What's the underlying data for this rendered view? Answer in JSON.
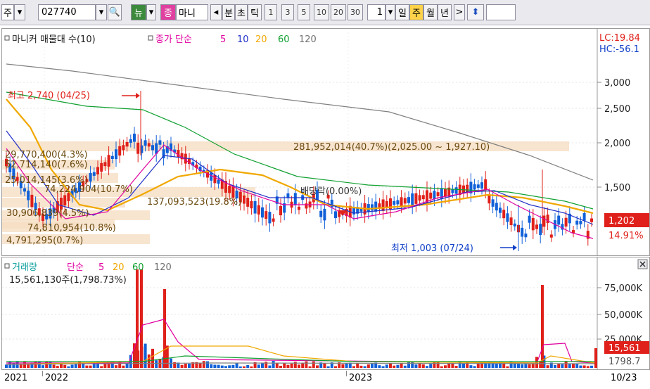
{
  "toolbar": {
    "market": "주",
    "code": "027740",
    "news_label": "뉴",
    "jong_label": "종",
    "name": "마니",
    "periods": [
      "분",
      "초",
      "틱"
    ],
    "intervals": [
      "1",
      "3",
      "5",
      "10",
      "20",
      "30"
    ],
    "count": "1",
    "day": "일",
    "week": "주",
    "month": "월",
    "year": "년"
  },
  "main_chart": {
    "legend_name": "마니커 매물대 수(10)",
    "legend_ma_label": "종가 단순",
    "ma_periods": [
      "5",
      "10",
      "20",
      "60",
      "120"
    ],
    "lc_text": "LC:19.84",
    "hc_text": "HC:-56.1",
    "y_ticks": [
      "3,000",
      "2,500",
      "2,000",
      "1,500"
    ],
    "current_price": "1,202",
    "current_change": "14.91%",
    "high_note": "최고 2,740 (04/25)",
    "low_note": "최저 1,003 (07/24)",
    "ex_div_note": "배당락(0.00%)",
    "volume_profile": [
      "281,952,014(40.7%)(2,025.00 ~ 1,927.10)",
      "137,093,523(19.8%)",
      "29,770,400(4.3%)",
      "52,714,140(7.6%)",
      "25,014,145(3.6%)",
      "74,224,904(10.7%)",
      "30,906,839(4.5%)",
      "74,810,954(10.8%)",
      "4,791,295(0.7%)"
    ]
  },
  "volume_chart": {
    "legend_name": "거래량",
    "legend_ma_label": "단순",
    "ma_periods": [
      "5",
      "20",
      "60",
      "120"
    ],
    "summary": "15,561,130주(1,798.73%)",
    "y_ticks": [
      "75,000K",
      "50,000K",
      "25,000K"
    ],
    "current_volume": "15,561",
    "current_ma": "1798.7"
  },
  "x_axis": [
    "2021",
    "2022",
    "2023",
    "10/23"
  ],
  "colors": {
    "up": "#e0201a",
    "down": "#1060d8",
    "ma5": "#e000a0",
    "ma10": "#2030c8",
    "ma20": "#f0a800",
    "ma60": "#10a030",
    "ma120": "#808080",
    "profile": "#f6dcc0"
  }
}
